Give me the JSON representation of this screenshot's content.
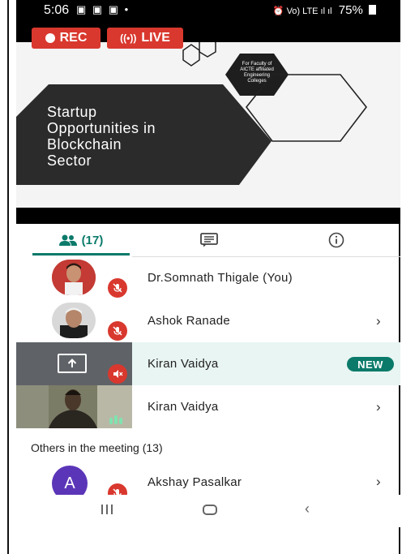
{
  "status_bar": {
    "time": "5:06",
    "left_icons": "▣ ▣ ▣ •",
    "right_icons": "⏰ Vo) LTE ıl ıl",
    "battery_percent": "75%"
  },
  "video": {
    "rec_label": "REC",
    "live_label": "LIVE",
    "slide": {
      "title_lines": [
        "Startup",
        "Opportunities in",
        "Blockchain",
        "Sector"
      ],
      "badge_lines": [
        "For Faculty of",
        "AICTE affiliated",
        "Engineering",
        "Colleges"
      ]
    }
  },
  "tabs": {
    "people_label": "(17)",
    "chat_icon": "chat-icon",
    "info_icon": "info-icon"
  },
  "participants": [
    {
      "name": "Dr.Somnath Thigale (You)",
      "muted": true
    },
    {
      "name": "Ashok Ranade",
      "muted": true
    },
    {
      "name": "Kiran Vaidya",
      "presenting": true,
      "badge": "NEW"
    },
    {
      "name": "Kiran Vaidya",
      "speaking": true
    }
  ],
  "others": {
    "heading": "Others in the meeting (13)",
    "items": [
      {
        "name": "Akshay Pasalkar",
        "initial": "A",
        "avatar_color": "#5b35b8"
      }
    ]
  },
  "colors": {
    "accent": "#0b7a6a",
    "rec_red": "#d9382e",
    "presenting_row_bg": "#e8f5f2"
  },
  "icons": [
    "people-icon",
    "chat-icon",
    "info-icon",
    "mic-off-icon",
    "present-screen-icon",
    "chevron-right-icon",
    "recents-icon",
    "home-icon",
    "back-icon"
  ]
}
